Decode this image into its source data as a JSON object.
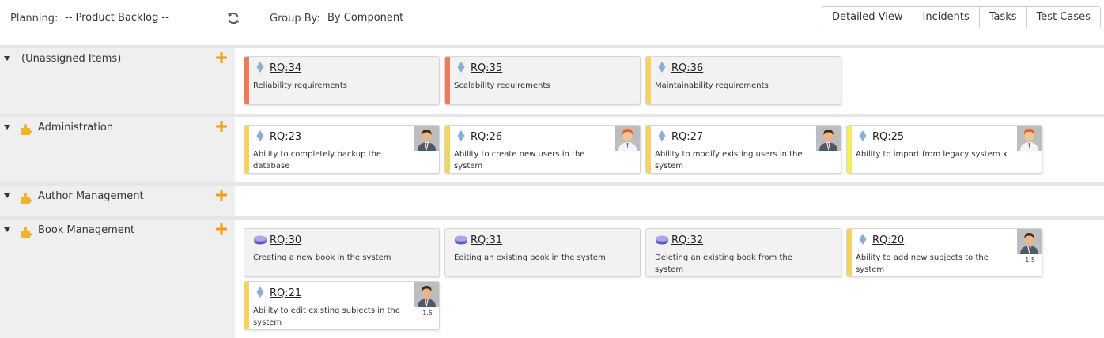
{
  "toolbar": {
    "planning_label": "Planning:",
    "planning_value": "-- Product Backlog --",
    "group_by_label": "Group By:",
    "group_by_value": "By Component",
    "views": [
      "Detailed View",
      "Incidents",
      "Tasks",
      "Test Cases"
    ]
  },
  "colors": {
    "accent_orange": "#f39c12",
    "priority_red": "#ee7a5a",
    "priority_yellow": "#f4d35e",
    "priority_light_yellow": "#f5ee5a",
    "row_sidebar": "#efefef"
  },
  "groups": [
    {
      "title": "(Unassigned Items)",
      "icon": "none",
      "cards": [
        {
          "id": "RQ:34",
          "desc": "Reliability requirements",
          "icon": "diamond-icon",
          "priority_color": "#ee7a5a"
        },
        {
          "id": "RQ:35",
          "desc": "Scalability requirements",
          "icon": "diamond-icon",
          "priority_color": "#ee7a5a"
        },
        {
          "id": "RQ:36",
          "desc": "Maintainability requirements",
          "icon": "diamond-icon",
          "priority_color": "#f4d35e"
        }
      ]
    },
    {
      "title": "Administration",
      "icon": "puzzle-icon",
      "cards": [
        {
          "id": "RQ:23",
          "desc": "Ability to completely backup the database",
          "icon": "diamond-icon",
          "priority_color": "#f4d35e",
          "avatar": "man-avatar"
        },
        {
          "id": "RQ:26",
          "desc": "Ability to create new users in the system",
          "icon": "diamond-icon",
          "priority_color": "#f4d35e",
          "avatar": "redhead-avatar"
        },
        {
          "id": "RQ:27",
          "desc": "Ability to modify existing users in the system",
          "icon": "diamond-icon",
          "priority_color": "#f4d35e",
          "avatar": "man-avatar"
        },
        {
          "id": "RQ:25",
          "desc": "Ability to import from legacy system x",
          "icon": "diamond-icon",
          "priority_color": "#f5ee5a",
          "avatar": "redhead-avatar"
        }
      ]
    },
    {
      "title": "Author Management",
      "icon": "puzzle-icon",
      "cards": []
    },
    {
      "title": "Book Management",
      "icon": "puzzle-icon",
      "cards": [
        {
          "id": "RQ:30",
          "desc": "Creating a new book in the system",
          "icon": "disk-icon"
        },
        {
          "id": "RQ:31",
          "desc": "Editing an existing book in the system",
          "icon": "disk-icon"
        },
        {
          "id": "RQ:32",
          "desc": "Deleting an existing book from the system",
          "icon": "disk-icon"
        },
        {
          "id": "RQ:20",
          "desc": "Ability to add new subjects to the system",
          "icon": "diamond-icon",
          "priority_color": "#f4d35e",
          "avatar": "man-avatar",
          "estimate": "1.5"
        },
        {
          "id": "RQ:21",
          "desc": "Ability to edit existing subjects in the system",
          "icon": "diamond-icon",
          "priority_color": "#f4d35e",
          "avatar": "man-avatar",
          "estimate": "1.5"
        }
      ]
    }
  ]
}
